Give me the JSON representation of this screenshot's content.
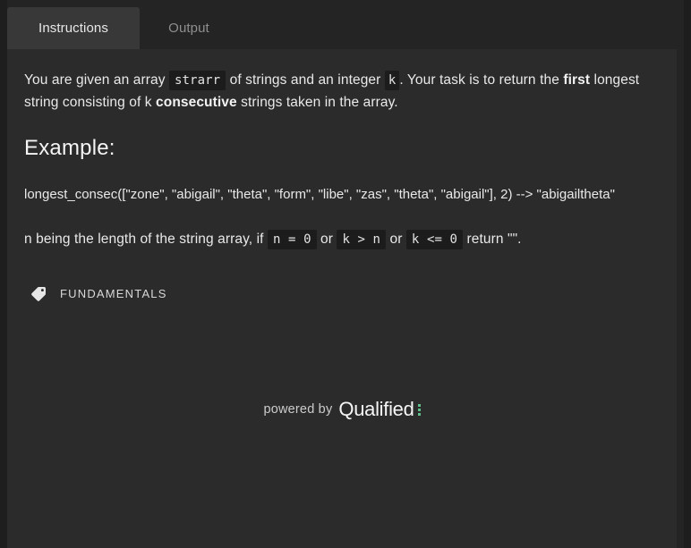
{
  "tabs": [
    {
      "label": "Instructions",
      "active": true,
      "name": "tab-instructions"
    },
    {
      "label": "Output",
      "active": false,
      "name": "tab-output"
    }
  ],
  "instructions": {
    "paragraph1": {
      "t1": "You are given an array ",
      "code1": "strarr",
      "t2": " of strings and an integer ",
      "code2": "k",
      "t3": ". Your task is to return the ",
      "bold1": "first",
      "t4": " longest string consisting of k ",
      "bold2": "consecutive",
      "t5": " strings taken in the array."
    },
    "example_heading": "Example:",
    "example_code": "longest_consec([\"zone\", \"abigail\", \"theta\", \"form\", \"libe\", \"zas\", \"theta\", \"abigail\"], 2) --> \"abigailtheta\"",
    "paragraph3": {
      "t1": "n being the length of the string array, if ",
      "code1": "n = 0",
      "t2": " or ",
      "code2": "k > n",
      "t3": " or ",
      "code3": "k <= 0",
      "t4": " return \"\"."
    }
  },
  "tag": {
    "icon": "tag-icon",
    "label": "FUNDAMENTALS"
  },
  "footer": {
    "powered_by": "powered by",
    "brand": "Qualified",
    "logo_mark": "colon-dots-icon"
  },
  "colors": {
    "page_background": "#222222",
    "panel_background": "#2b2b2b",
    "active_tab": "#383838",
    "gutter": "#1e1e1e",
    "inline_code_background": "#1c1c1c",
    "text_primary": "#e9e9e9",
    "text_muted": "#8e8e8e",
    "brand_accent": "#5fbf8a"
  }
}
